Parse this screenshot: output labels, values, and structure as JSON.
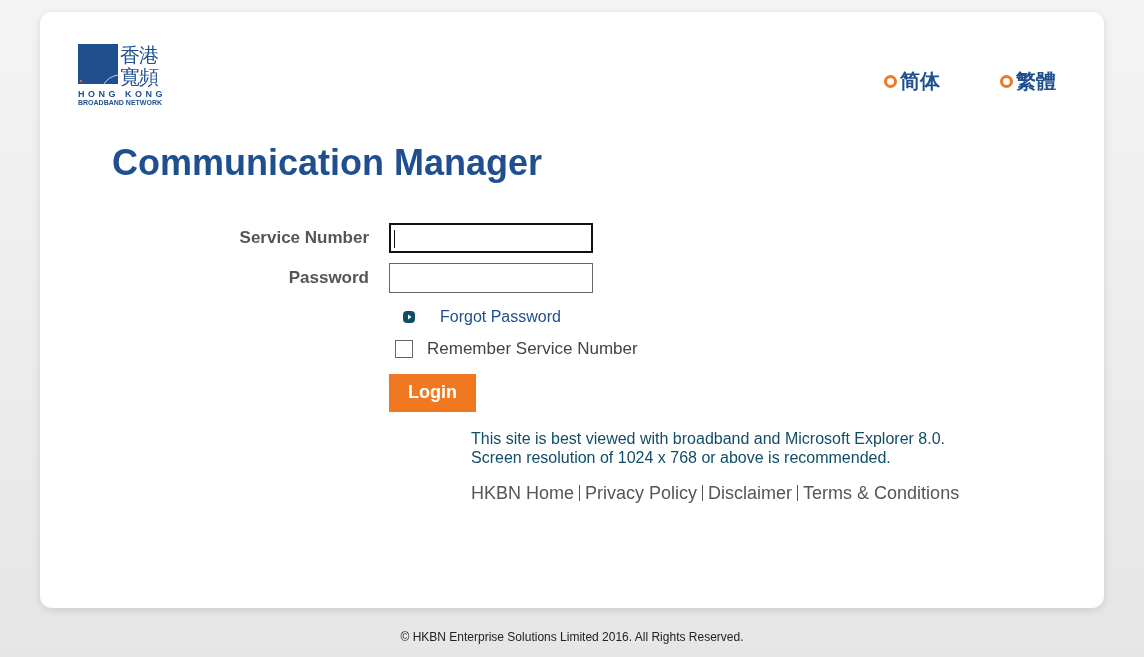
{
  "logo": {
    "characters": [
      "香港",
      "寬頻"
    ],
    "wordmark": "HONG KONG",
    "tagline": "BROADBAND NETWORK"
  },
  "languages": [
    {
      "label": "简体"
    },
    {
      "label": "繁體"
    }
  ],
  "title": "Communication Manager",
  "form": {
    "fields": [
      {
        "label": "Service Number",
        "focused": true
      },
      {
        "label": "Password",
        "focused": false
      }
    ],
    "forgot_link": "Forgot Password",
    "remember": {
      "label": "Remember Service Number",
      "checked": false
    },
    "login_button": "Login"
  },
  "notes": [
    "This site is best viewed with broadband and Microsoft Explorer 8.0.",
    "Screen resolution of 1024 x 768 or above is recommended."
  ],
  "footer_links": [
    "HKBN Home",
    "Privacy Policy",
    "Disclaimer",
    "Terms & Conditions"
  ],
  "copyright": "© HKBN Enterprise Solutions Limited 2016. All Rights Reserved."
}
